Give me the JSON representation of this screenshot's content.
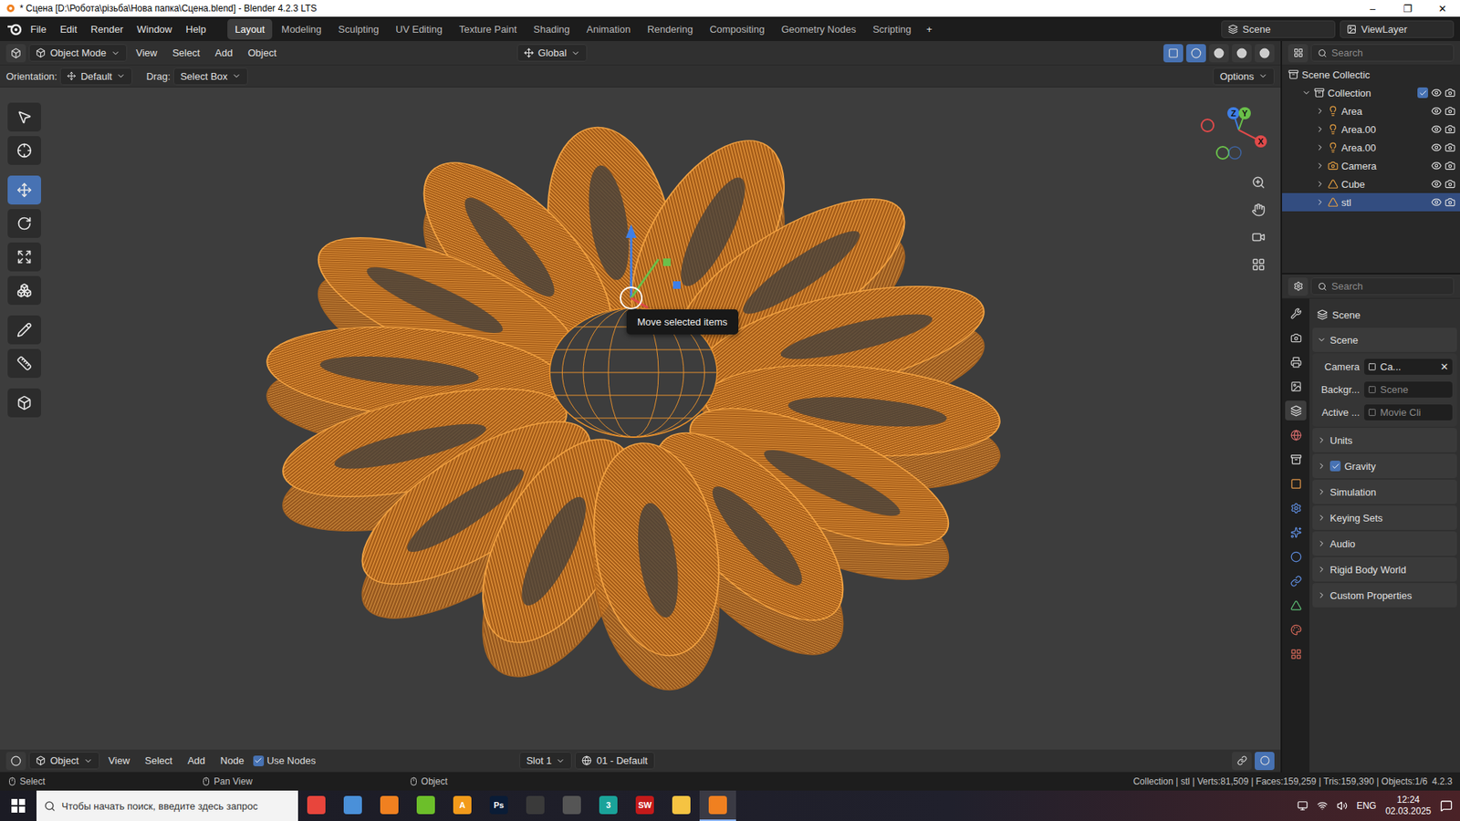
{
  "window": {
    "title": "* Сцена [D:\\Робота\\різьба\\Нова папка\\Сцена.blend] - Blender 4.2.3 LTS",
    "controls": [
      "–",
      "❐",
      "✕"
    ]
  },
  "menu": [
    "File",
    "Edit",
    "Render",
    "Window",
    "Help"
  ],
  "workspaces": [
    {
      "label": "Layout",
      "selected": true
    },
    {
      "label": "Modeling",
      "selected": false
    },
    {
      "label": "Sculpting",
      "selected": false
    },
    {
      "label": "UV Editing",
      "selected": false
    },
    {
      "label": "Texture Paint",
      "selected": false
    },
    {
      "label": "Shading",
      "selected": false
    },
    {
      "label": "Animation",
      "selected": false
    },
    {
      "label": "Rendering",
      "selected": false
    },
    {
      "label": "Compositing",
      "selected": false
    },
    {
      "label": "Geometry Nodes",
      "selected": false
    },
    {
      "label": "Scripting",
      "selected": false
    }
  ],
  "add_workspace": "+",
  "scene": "Scene",
  "view_layer": "ViewLayer",
  "viewport_header": {
    "mode": "Object Mode",
    "menus": [
      "View",
      "Select",
      "Add",
      "Object"
    ],
    "orientation": "Global",
    "xray": true,
    "shading": [
      {
        "selected": true
      },
      {
        "selected": false
      },
      {
        "selected": false
      },
      {
        "selected": false
      }
    ]
  },
  "tool_settings": {
    "orientation_label": "Orientation:",
    "orientation": "Default",
    "drag_label": "Drag:",
    "drag": "Select Box",
    "options": "Options"
  },
  "toolbar": [
    {
      "selected": false
    },
    {
      "selected": false
    },
    {
      "selected": true
    },
    {
      "selected": false
    },
    {
      "selected": false
    },
    {
      "selected": false
    },
    {
      "selected": false
    },
    {
      "selected": false
    },
    {
      "selected": false
    }
  ],
  "gizmo": {
    "z": "Z",
    "y": "Y",
    "x": "X"
  },
  "tooltip": "Move selected items",
  "outliner": {
    "search_placeholder": "Search",
    "root": "Scene Collectic",
    "items": [
      {
        "name": "Collection",
        "kind": "collection",
        "depth": 1,
        "selected": false,
        "checked": true,
        "visible": true,
        "renderable": true
      },
      {
        "name": "Area",
        "kind": "light",
        "depth": 2,
        "selected": false,
        "checked": false,
        "visible": true,
        "renderable": true
      },
      {
        "name": "Area.00",
        "kind": "light",
        "depth": 2,
        "selected": false,
        "checked": false,
        "visible": true,
        "renderable": true
      },
      {
        "name": "Area.00",
        "kind": "light",
        "depth": 2,
        "selected": false,
        "checked": false,
        "visible": true,
        "renderable": true
      },
      {
        "name": "Camera",
        "kind": "camera",
        "depth": 2,
        "selected": false,
        "checked": false,
        "visible": true,
        "renderable": true
      },
      {
        "name": "Cube",
        "kind": "mesh",
        "depth": 2,
        "selected": false,
        "checked": false,
        "visible": true,
        "renderable": true
      },
      {
        "name": "stl",
        "kind": "mesh",
        "depth": 2,
        "selected": true,
        "checked": false,
        "visible": true,
        "renderable": true
      }
    ]
  },
  "properties": {
    "search_placeholder": "Search",
    "context": "Scene",
    "tabs": [
      {
        "selected": false
      },
      {
        "selected": false
      },
      {
        "selected": false
      },
      {
        "selected": false
      },
      {
        "selected": true
      },
      {
        "selected": false
      },
      {
        "selected": false
      },
      {
        "selected": false
      },
      {
        "selected": false
      },
      {
        "selected": false
      },
      {
        "selected": false
      },
      {
        "selected": false
      },
      {
        "selected": false
      },
      {
        "selected": false
      },
      {
        "selected": false
      }
    ],
    "main_panel": {
      "title": "Scene",
      "expanded": true,
      "fields": [
        {
          "label": "Camera",
          "value": "Ca...",
          "greyed": false,
          "clear": "✕"
        },
        {
          "label": "Backgr...",
          "value": "Scene",
          "greyed": true,
          "clear": ""
        },
        {
          "label": "Active ...",
          "value": "Movie Cli",
          "greyed": true,
          "clear": ""
        }
      ]
    },
    "panels": [
      {
        "title": "Units",
        "kind": "plain",
        "checked": false,
        "expanded": false
      },
      {
        "title": "Gravity",
        "kind": "checkbox",
        "checked": true,
        "expanded": false
      },
      {
        "title": "Simulation",
        "kind": "plain",
        "checked": false,
        "expanded": false
      },
      {
        "title": "Keying Sets",
        "kind": "plain",
        "checked": false,
        "expanded": false
      },
      {
        "title": "Audio",
        "kind": "plain",
        "checked": false,
        "expanded": false
      },
      {
        "title": "Rigid Body World",
        "kind": "plain",
        "checked": false,
        "expanded": false
      },
      {
        "title": "Custom Properties",
        "kind": "plain",
        "checked": false,
        "expanded": false
      }
    ]
  },
  "editor_header": {
    "mode": "Object",
    "menus": [
      "View",
      "Select",
      "Add",
      "Node"
    ],
    "use_nodes": {
      "label": "Use Nodes",
      "checked": true
    },
    "slot": "Slot 1",
    "material": "01 - Default"
  },
  "status_bar": {
    "hints": [
      "Select",
      "Pan View",
      "Object"
    ],
    "stats": "Collection | stl | Verts:81,509 | Faces:159,259 | Tris:159,390 | Objects:1/6",
    "version": "4.2.3"
  },
  "taskbar": {
    "search_placeholder": "Чтобы начать поиск, введите здесь запрос",
    "apps": [
      {
        "label": "",
        "color": "#e8453c",
        "active": false
      },
      {
        "label": "",
        "color": "#4a90d9",
        "active": false
      },
      {
        "label": "",
        "color": "#f08020",
        "active": false
      },
      {
        "label": "",
        "color": "#6cbf2a",
        "active": false
      },
      {
        "label": "A",
        "color": "#f29a1b",
        "active": false
      },
      {
        "label": "Ps",
        "color": "#0a1c36",
        "active": false
      },
      {
        "label": "",
        "color": "#3a3a3a",
        "active": false
      },
      {
        "label": "",
        "color": "#555555",
        "active": false
      },
      {
        "label": "3",
        "color": "#1aa39a",
        "active": false
      },
      {
        "label": "SW",
        "color": "#c41a1a",
        "active": false
      },
      {
        "label": "",
        "color": "#f5c342",
        "active": false
      },
      {
        "label": "",
        "color": "#f08020",
        "active": true
      }
    ],
    "language": "ENG",
    "time": "12:24",
    "date": "02.03.2025"
  }
}
